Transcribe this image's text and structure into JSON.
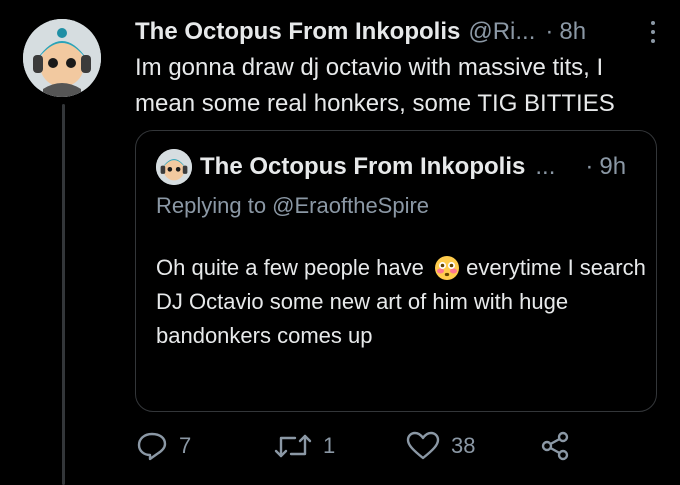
{
  "tweet": {
    "author_name": "The Octopus From Inkopolis",
    "author_handle": "@Ri...",
    "separator": "·",
    "time": "8h",
    "text": "Im gonna draw dj octavio with massive tits, I mean some real honkers, some TIG BITTIES"
  },
  "quoted_tweet": {
    "author_name": "The Octopus From Inkopolis",
    "ellipsis": "...",
    "separator": "·",
    "time": "9h",
    "replying_to": "Replying to @EraoftheSpire",
    "text_before_emoji": "Oh quite a few people have",
    "emoji": "flushed-face",
    "text_after_emoji": "everytime I search DJ Octavio some new art of him with huge bandonkers comes up"
  },
  "actions": {
    "reply_count": "7",
    "retweet_count": "1",
    "like_count": "38"
  },
  "icons": [
    "more-icon",
    "reply-icon",
    "retweet-icon",
    "like-icon",
    "share-icon"
  ],
  "colors": {
    "background": "#000000",
    "text_primary": "#e7e9ea",
    "text_secondary": "#8b98a5",
    "border": "#333639"
  }
}
